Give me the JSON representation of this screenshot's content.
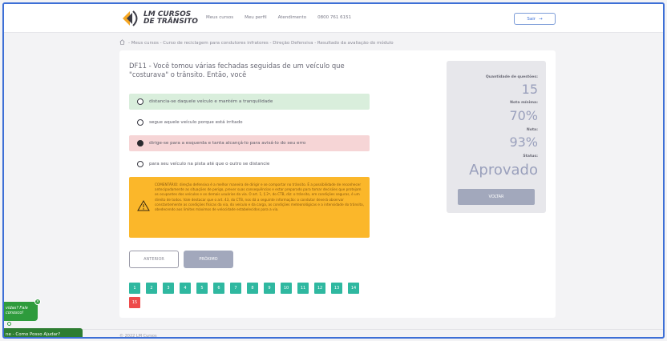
{
  "header": {
    "logo_line1": "LM CURSOS",
    "logo_line2": "DE TRÂNSITO",
    "nav": [
      "Meus cursos",
      "Meu perfil",
      "Atendimento",
      "0800 761 6151"
    ],
    "logout_label": "Sair"
  },
  "breadcrumb": "- Meus cursos - Curso de reciclagem para condutores infratores - Direção Defensiva - Resultado da avaliação do módulo",
  "question": {
    "text": "DF11 - Você tomou várias fechadas seguidas de um veículo que \"costurava\" o trânsito. Então, você",
    "options": [
      {
        "label": "distancia-se daquele veículo e mantém a tranquilidade",
        "state": "correct"
      },
      {
        "label": "segue aquele veículo porque está irritado",
        "state": "none"
      },
      {
        "label": "dirige-se para a esquerda e tanta alcançá-lo para avisá-lo do seu erro",
        "state": "wrong"
      },
      {
        "label": "para seu veículo na pista até que o outro se distancie",
        "state": "none"
      }
    ]
  },
  "comment": "COMENTÁRIO: direção defensiva é a melhor maneira de dirigir e se comportar no trânsito. É a possibilidade de reconhecer antecipadamente as situações de perigo, prever suas consequências e estar preparado para tomar decisões que protejam os ocupantes dos veículos e os demais usuários da via. O art. 1, § 2º, do CTB, diz: o trânsito, em condições seguras, é um direito de todos. Vale destacar que o art. 43, do CTB, nos dá a seguinte informação: o condutor deverá observar constantemente as condições físicas da via, do veículo e da carga, as condições meteorológicas e a intensidade do trânsito, obedecendo aos limites máximos de velocidade estabelecidos para a via.",
  "buttons": {
    "prev": "ANTERIOR",
    "next": "PRÓXIMO",
    "back": "VOLTAR"
  },
  "pages": {
    "items": [
      "1",
      "2",
      "3",
      "4",
      "5",
      "6",
      "7",
      "8",
      "9",
      "10",
      "11",
      "12",
      "13",
      "14",
      "15"
    ],
    "wrong": [
      "15"
    ]
  },
  "stats": {
    "questions_label": "Quantidade de questões:",
    "questions_value": "15",
    "min_label": "Nota mínima:",
    "min_value": "70%",
    "score_label": "Nota:",
    "score_value": "93%",
    "status_label": "Status:",
    "status_value": "Aprovado"
  },
  "footer": "© 2022 LM Cursos",
  "chat": {
    "bubble": "vidas? Fale conosco!",
    "bar": "ne - Como Posso Ajudar?"
  },
  "colors": {
    "accent": "#3d6fd6",
    "correct_bg": "#d9eedc",
    "wrong_bg": "#f6d5d6",
    "comment_bg": "#fbb72a",
    "page_ok": "#2fb8a0",
    "page_wrong": "#ee4b4b",
    "whatsapp": "#2e7d32"
  }
}
